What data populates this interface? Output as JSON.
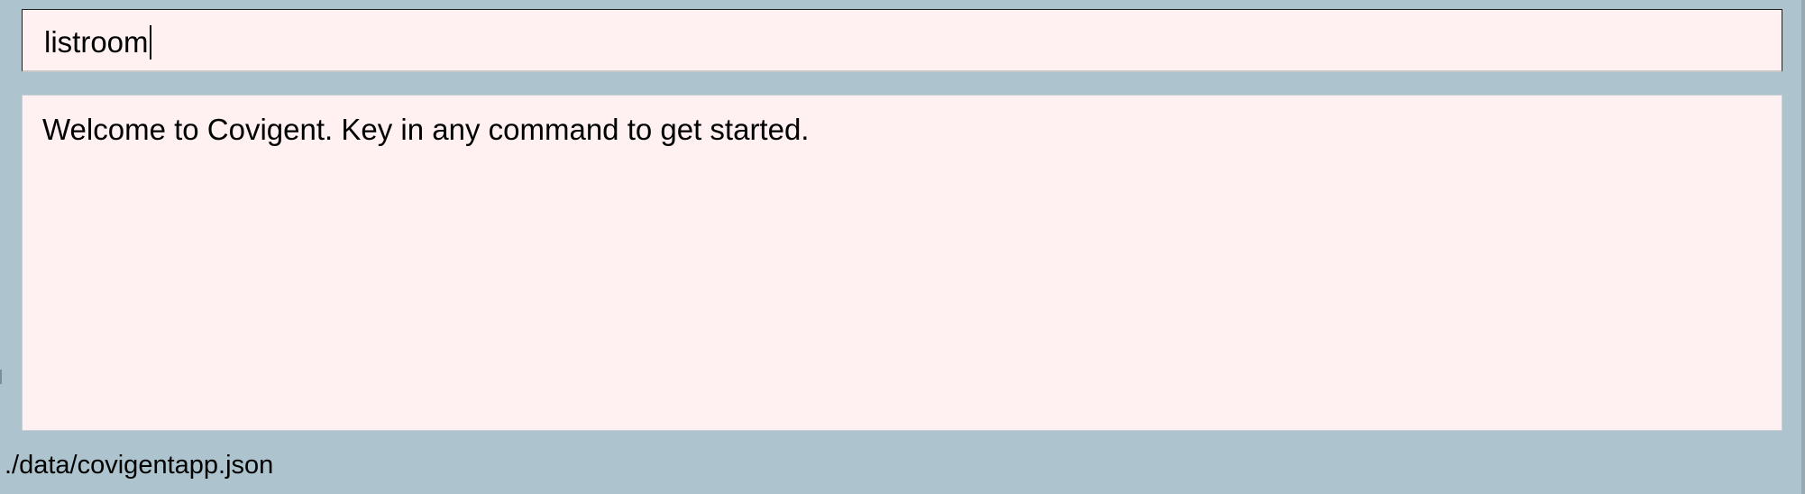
{
  "command_box": {
    "value": "listroom"
  },
  "result_display": {
    "text": "Welcome to Covigent. Key in any command to get started."
  },
  "status_bar": {
    "file_path": "./data/covigentapp.json"
  },
  "colors": {
    "window_background": "#adc4cf",
    "panel_background": "#fff0f1",
    "text": "#000000"
  }
}
